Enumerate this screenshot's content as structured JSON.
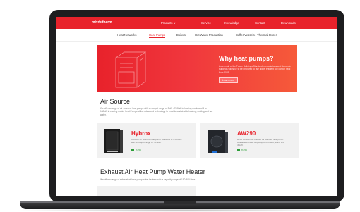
{
  "site": {
    "logo": "mixdutherm",
    "nav": [
      "Products ∨",
      "Service",
      "Knowledge",
      "Contact",
      "Downloads"
    ]
  },
  "subnav": {
    "items": [
      "Heat Networks",
      "Heat Pumps",
      "Boilers",
      "Hot Water Production",
      "Buffer Vessels / Thermal Stores"
    ],
    "active_index": 1
  },
  "hero": {
    "title": "Why heat pumps?",
    "text": "As a result of the Future Buildings Standard, consultations and domestic buildings will have to be prepared to use highly efficient low carbon heat from 2025.",
    "button": "Learn more"
  },
  "air_source": {
    "title": "Air Source",
    "text": "We offer a range of air sourced heat pumps with an output range of 3kW - 700kW in heating mode and 5 to 180kW in cooling mode. Heat Pumps utilise advanced technology to provide sustainable heating, cooling and hot water."
  },
  "cards": [
    {
      "title": "Hybrox",
      "text": "Outdoor air sourced heat pump. Available in 3 models with an output range of 7-16kW.",
      "tag": "R290"
    },
    {
      "title": "AW290",
      "text": "R290 commercial outdoor air sourced heat pump. Available in three output options: 20kW, 30kW and 45kW.",
      "tag": "R290"
    }
  ],
  "exhaust": {
    "title": "Exhaust Air Heat Pump Water Heater",
    "text": "We offer a range of exhaust air heat pump water heaters with a capacity range of 190-300 litres."
  },
  "colors": {
    "brand_red": "#e8222b",
    "tag_green": "#2e9e3a",
    "bezel": "#1d1d1f"
  }
}
